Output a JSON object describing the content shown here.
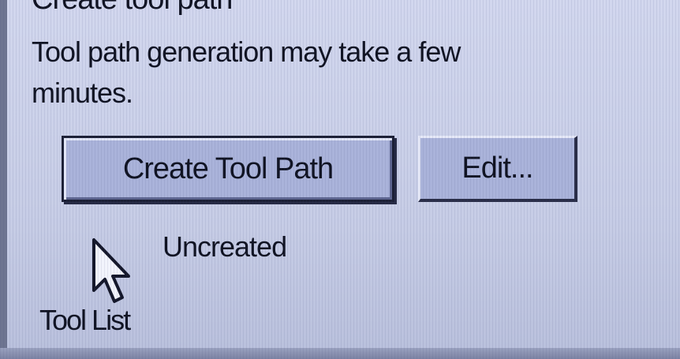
{
  "dialog": {
    "heading": "Create tool path",
    "message": "Tool path generation may take a few minutes."
  },
  "buttons": {
    "create_label": "Create Tool Path",
    "edit_label": "Edit..."
  },
  "status": {
    "text": "Uncreated"
  },
  "footer": {
    "tool_list_label": "Tool List"
  },
  "icons": {
    "cursor": "arrow-cursor-icon"
  }
}
